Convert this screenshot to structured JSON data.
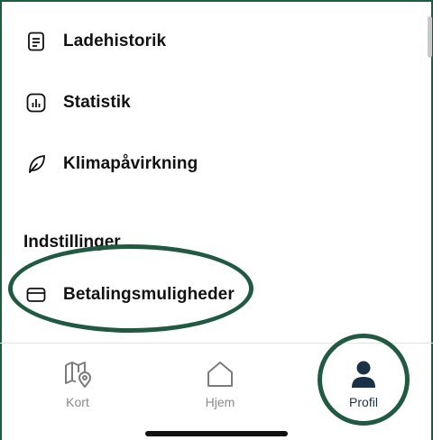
{
  "menu": {
    "items": [
      {
        "label": "Ladehistorik",
        "icon": "document-list-icon"
      },
      {
        "label": "Statistik",
        "icon": "bar-chart-icon"
      },
      {
        "label": "Klimapåvirkning",
        "icon": "leaf-icon"
      }
    ]
  },
  "settings": {
    "title": "Indstillinger",
    "items": [
      {
        "label": "Betalingsmuligheder",
        "icon": "credit-card-icon"
      }
    ]
  },
  "tabbar": {
    "tabs": [
      {
        "label": "Kort",
        "icon": "map-pin-icon",
        "active": false
      },
      {
        "label": "Hjem",
        "icon": "home-icon",
        "active": false
      },
      {
        "label": "Profil",
        "icon": "person-icon",
        "active": true
      }
    ]
  },
  "colors": {
    "annotation": "#1f5a41",
    "active_tab": "#1b3148",
    "inactive_tab": "#8a8a8a"
  }
}
